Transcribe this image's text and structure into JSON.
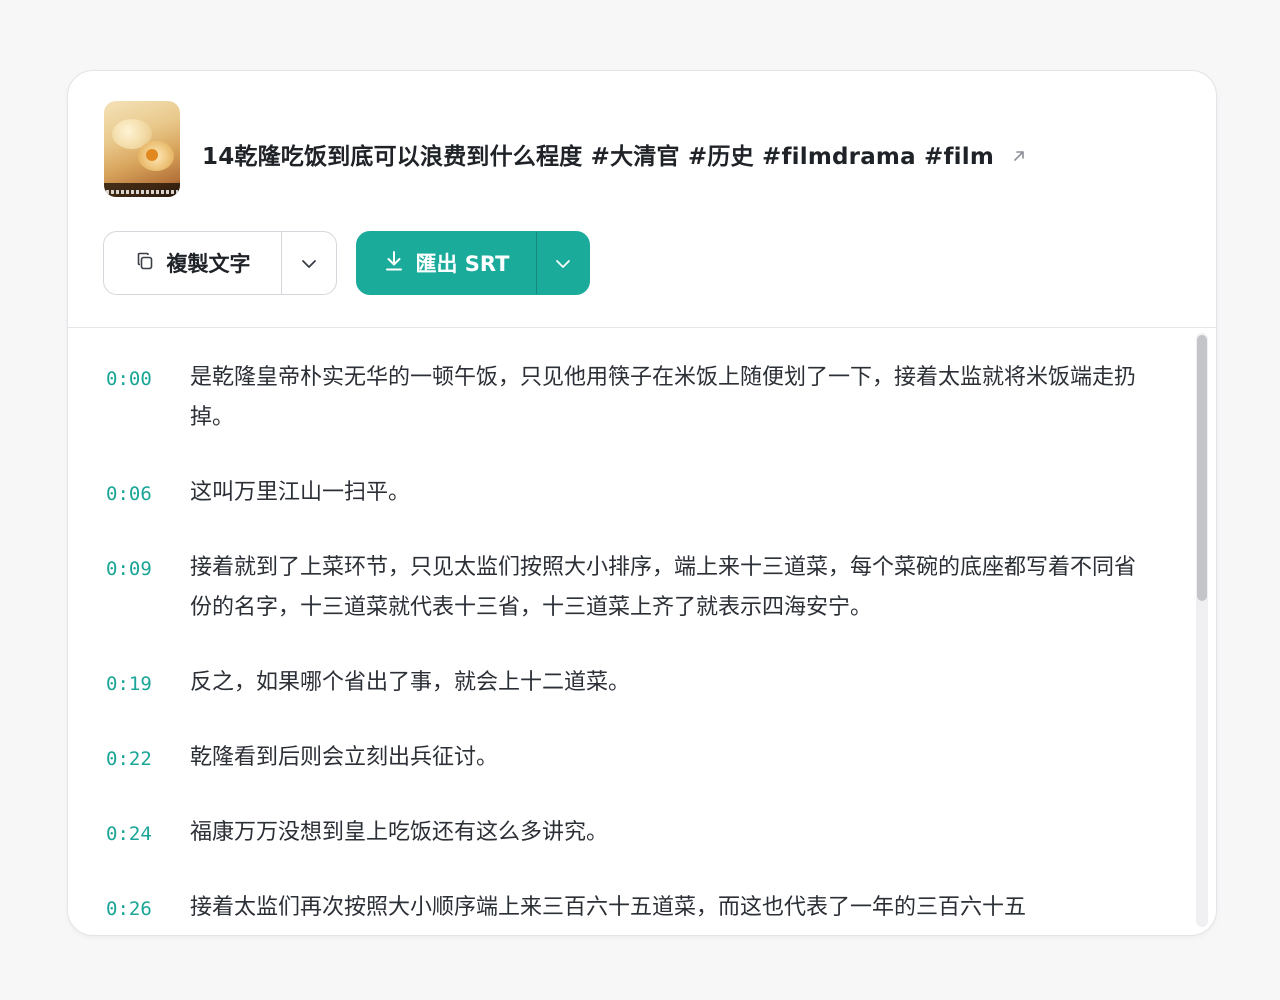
{
  "video": {
    "title": "14乾隆吃饭到底可以浪费到什么程度 #大清官 #历史 #filmdrama #film",
    "thumbnail_icon": "video-thumbnail"
  },
  "toolbar": {
    "copy_label": "複製文字",
    "export_label": "匯出 SRT",
    "accent_color": "#1aab9b"
  },
  "transcript": [
    {
      "time": "0:00",
      "text": "是乾隆皇帝朴实无华的一顿午饭，只见他用筷子在米饭上随便划了一下，接着太监就将米饭端走扔掉。"
    },
    {
      "time": "0:06",
      "text": "这叫万里江山一扫平。"
    },
    {
      "time": "0:09",
      "text": "接着就到了上菜环节，只见太监们按照大小排序，端上来十三道菜，每个菜碗的底座都写着不同省份的名字，十三道菜就代表十三省，十三道菜上齐了就表示四海安宁。"
    },
    {
      "time": "0:19",
      "text": "反之，如果哪个省出了事，就会上十二道菜。"
    },
    {
      "time": "0:22",
      "text": "乾隆看到后则会立刻出兵征讨。"
    },
    {
      "time": "0:24",
      "text": "福康万万没想到皇上吃饭还有这么多讲究。"
    },
    {
      "time": "0:26",
      "text": "接着太监们再次按照大小顺序端上来三百六十五道菜，而这也代表了一年的三百六十五"
    }
  ]
}
